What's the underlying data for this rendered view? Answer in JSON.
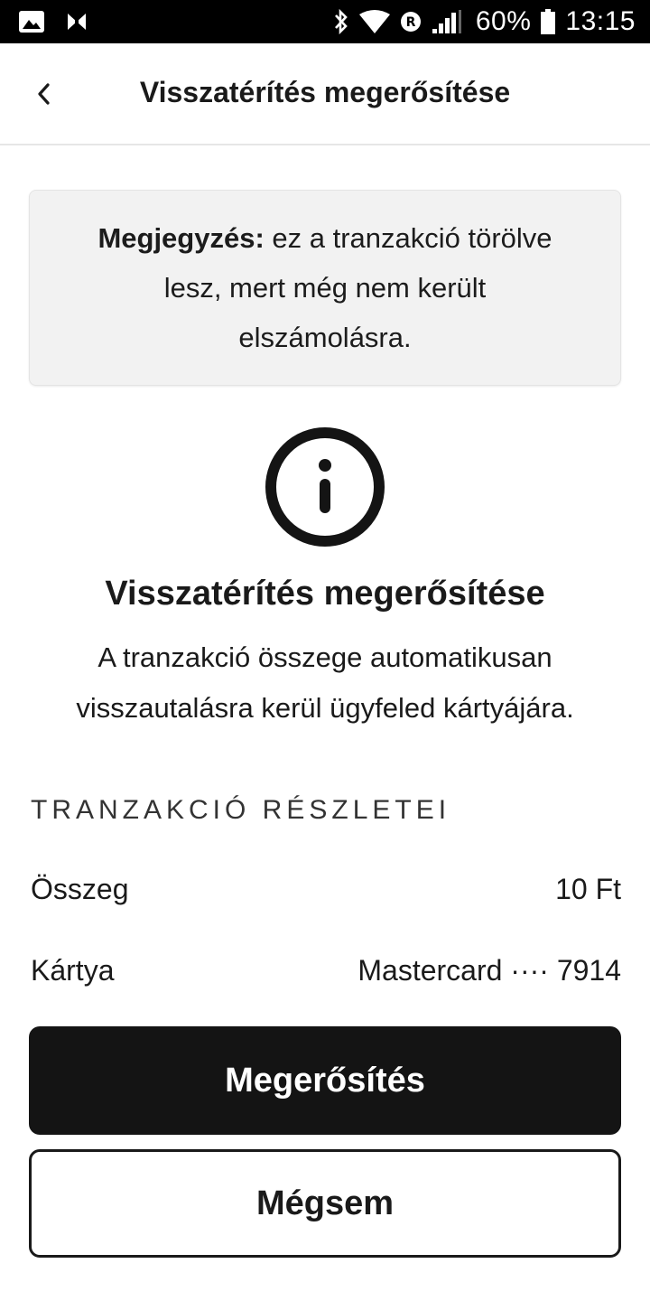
{
  "status_bar": {
    "battery_percent": "60%",
    "time": "13:15",
    "icons": [
      "image-icon",
      "app-icon",
      "bluetooth-icon",
      "wifi-icon",
      "roaming-icon",
      "signal-icon",
      "battery-icon"
    ]
  },
  "header": {
    "title": "Visszatérítés megerősítése",
    "back_icon": "chevron-left-icon"
  },
  "note": {
    "label": "Megjegyzés:",
    "text": " ez a tranzakció törölve lesz, mert még nem került elszámolásra."
  },
  "info": {
    "icon": "info-icon",
    "heading": "Visszatérítés megerősítése",
    "description": "A tranzakció összege automatikusan visszautalásra kerül ügyfeled kártyájára."
  },
  "details": {
    "section_title": "TRANZAKCIÓ RÉSZLETEI",
    "rows": [
      {
        "label": "Összeg",
        "value": "10 Ft"
      },
      {
        "label": "Kártya",
        "value": "Mastercard ···· 7914"
      }
    ]
  },
  "actions": {
    "confirm_label": "Megerősítés",
    "cancel_label": "Mégsem"
  },
  "colors": {
    "primary_button": "#141414",
    "note_background": "#f2f2f2",
    "status_bar": "#000000"
  }
}
